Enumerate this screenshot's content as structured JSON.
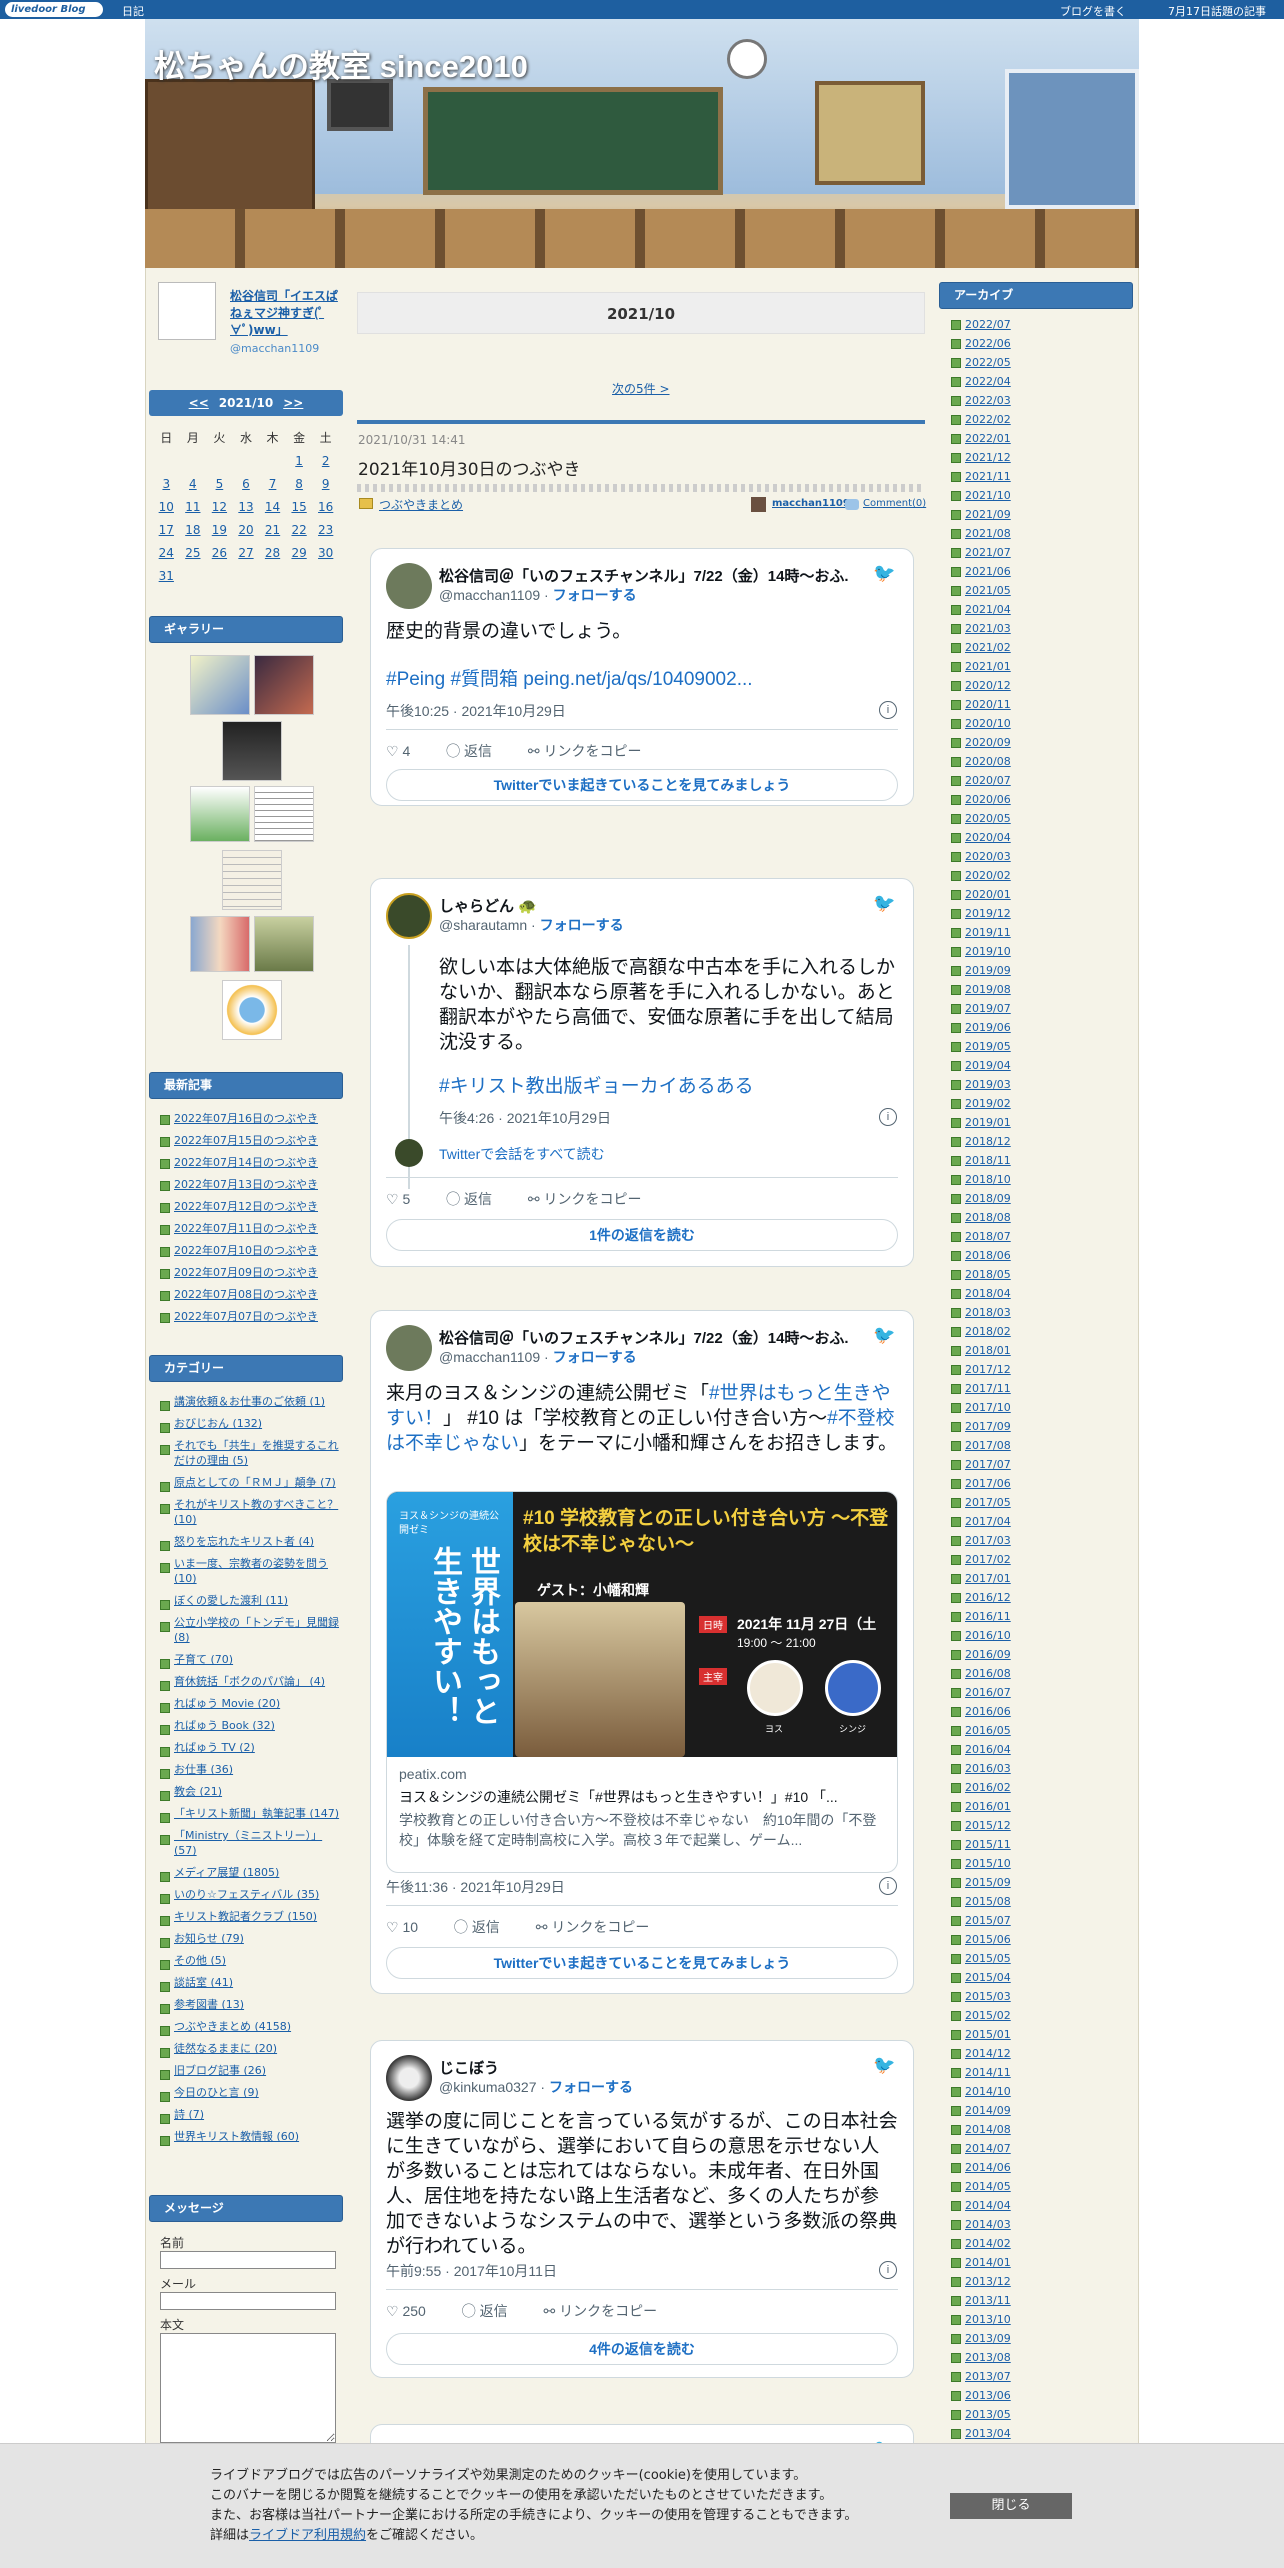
{
  "topbar": {
    "logo": "livedoor Blog",
    "diary": "日記",
    "write": "ブログを書く",
    "trend": "7月17日話題の記事"
  },
  "header": {
    "title": "松ちゃんの教室 since2010"
  },
  "profile": {
    "name": "松谷信司「イエスぱねぇマジ神すぎ(ﾟ∀ﾟ)ww」",
    "handle": "@macchan1109"
  },
  "calendar": {
    "prev": "<<",
    "month": "2021/10",
    "next": ">>",
    "weekdays": [
      "日",
      "月",
      "火",
      "水",
      "木",
      "金",
      "土"
    ],
    "weeks": [
      [
        "",
        "",
        "",
        "",
        "",
        "1",
        "2"
      ],
      [
        "3",
        "4",
        "5",
        "6",
        "7",
        "8",
        "9"
      ],
      [
        "10",
        "11",
        "12",
        "13",
        "14",
        "15",
        "16"
      ],
      [
        "17",
        "18",
        "19",
        "20",
        "21",
        "22",
        "23"
      ],
      [
        "24",
        "25",
        "26",
        "27",
        "28",
        "29",
        "30"
      ],
      [
        "31",
        "",
        "",
        "",
        "",
        "",
        ""
      ]
    ]
  },
  "gallery": {
    "title": "ギャラリー"
  },
  "recent": {
    "title": "最新記事",
    "items": [
      "2022年07月16日のつぶやき",
      "2022年07月15日のつぶやき",
      "2022年07月14日のつぶやき",
      "2022年07月13日のつぶやき",
      "2022年07月12日のつぶやき",
      "2022年07月11日のつぶやき",
      "2022年07月10日のつぶやき",
      "2022年07月09日のつぶやき",
      "2022年07月08日のつぶやき",
      "2022年07月07日のつぶやき"
    ]
  },
  "categories": {
    "title": "カテゴリー",
    "items": [
      "講演依頼＆お仕事のご依頼 (1)",
      "おびじおん (132)",
      "それでも「共生」を推奨するこれだけの理由 (5)",
      "原点としての「ＲＭＪ」顛争 (7)",
      "それがキリスト教のすべきこと？ (10)",
      "怒りを忘れたキリスト者 (4)",
      "いま一度、宗教者の姿勢を問う (10)",
      "ぼくの愛した渡利 (11)",
      "公立小学校の「トンデモ」見聞録 (8)",
      "子育て (70)",
      "育休銃括「ボクのパパ論」 (4)",
      "ればゅう Movie (20)",
      "ればゅう Book (32)",
      "ればゅう TV (2)",
      "お仕事 (36)",
      "教会 (21)",
      "「キリスト新聞」執筆記事 (147)",
      "「Ministry（ミニストリー）」 (57)",
      "メディア展望 (1805)",
      "いのり☆フェスティバル (35)",
      "キリスト教記者クラブ (150)",
      "お知らせ (79)",
      "その他 (5)",
      "談話室 (41)",
      "参考図書 (13)",
      "つぶやきまとめ (4158)",
      "徒然なるままに (20)",
      "旧ブログ記事 (26)",
      "今日のひと言 (9)",
      "詩 (7)",
      "世界キリスト教情報 (60)"
    ]
  },
  "message": {
    "title": "メッセージ",
    "name_label": "名前",
    "mail_label": "メール",
    "body_label": "本文"
  },
  "main": {
    "date_head": "2021/10",
    "next_link": "次の5件 >",
    "post_date": "2021/10/31 14:41",
    "post_title": "2021年10月30日のつぶやき",
    "category": "つぶやきまとめ",
    "author": "macchan1109",
    "comments": "Comment(0)"
  },
  "tweets": [
    {
      "name": "松谷信司＠「いのフェスチャンネル」7/22（金）14時～おふ...",
      "handle": "@macchan1109",
      "follow": "フォローする",
      "text": "歴史的背景の違いでしょう。",
      "tags": "#Peing #質問箱 peing.net/ja/qs/10409002...",
      "time": "午後10:25 · 2021年10月29日",
      "likes": "4",
      "reply": "返信",
      "copy": "リンクをコピー",
      "button": "Twitterでいま起きていることを見てみましょう"
    },
    {
      "name": "しゃらどん",
      "handle": "@sharautamn",
      "follow": "フォローする",
      "text": "欲しい本は大体絶版で高額な中古本を手に入れるしかないか、翻訳本なら原著を手に入れるしかない。あと翻訳本がやたら高価で、安価な原著に手を出して結局沈没する。",
      "tags": "#キリスト教出版ギョーカイあるある",
      "time": "午後4:26 · 2021年10月29日",
      "thread": "Twitterで会話をすべて読む",
      "likes": "5",
      "reply": "返信",
      "copy": "リンクをコピー",
      "button": "1件の返信を読む"
    },
    {
      "name": "松谷信司＠「いのフェスチャンネル」7/22（金）14時～おふ...",
      "handle": "@macchan1109",
      "follow": "フォローする",
      "text1": "来月のヨス＆シンジの連続公開ゼミ「",
      "hl1": "#世界はもっと生きやすい！",
      "text2": "」 #10 は「学校教育との正しい付き合い方～",
      "hl2": "#不登校は不幸じゃない",
      "text3": "」をテーマに小幡和輝さんをお招きします。",
      "card_banner_top": "ヨス＆シンジの連続公開ゼミ",
      "card_banner_big": "世界はもっと生きやすい！",
      "card_title": "#10 学校教育との正しい付き合い方 〜不登校は不幸じゃない〜",
      "card_guest": "ゲスト：小幡和輝",
      "card_date_tag": "日時",
      "card_date": "2021年 11月 27日（土",
      "card_hours": "19:00 ～ 21:00",
      "card_host_tag": "主宰",
      "card_host1": "ヨス",
      "card_host2": "シンジ",
      "card_domain": "peatix.com",
      "card_headline": "ヨス＆シンジの連続公開ゼミ「#世界はもっと生きやすい！」#10 「...",
      "card_desc": "学校教育との正しい付き合い方～不登校は不幸じゃない　約10年間の「不登校」体験を経て定時制高校に入学。高校３年で起業し、ゲーム...",
      "time": "午後11:36 · 2021年10月29日",
      "likes": "10",
      "reply": "返信",
      "copy": "リンクをコピー",
      "button": "Twitterでいま起きていることを見てみましょう"
    },
    {
      "name": "じこぼう",
      "handle": "@kinkuma0327",
      "follow": "フォローする",
      "text": "選挙の度に同じことを言っている気がするが、この日本社会に生きていながら、選挙において自らの意思を示せない人が多数いることは忘れてはならない。未成年者、在日外国人、居住地を持たない路上生活者など、多くの人たちが参加できないようなシステムの中で、選挙という多数派の祭典が行われている。",
      "time": "午前9:55 · 2017年10月11日",
      "likes": "250",
      "reply": "返信",
      "copy": "リンクをコピー",
      "button": "4件の返信を読む"
    }
  ],
  "archive": {
    "title": "アーカイブ",
    "items": [
      "2022/07",
      "2022/06",
      "2022/05",
      "2022/04",
      "2022/03",
      "2022/02",
      "2022/01",
      "2021/12",
      "2021/11",
      "2021/10",
      "2021/09",
      "2021/08",
      "2021/07",
      "2021/06",
      "2021/05",
      "2021/04",
      "2021/03",
      "2021/02",
      "2021/01",
      "2020/12",
      "2020/11",
      "2020/10",
      "2020/09",
      "2020/08",
      "2020/07",
      "2020/06",
      "2020/05",
      "2020/04",
      "2020/03",
      "2020/02",
      "2020/01",
      "2019/12",
      "2019/11",
      "2019/10",
      "2019/09",
      "2019/08",
      "2019/07",
      "2019/06",
      "2019/05",
      "2019/04",
      "2019/03",
      "2019/02",
      "2019/01",
      "2018/12",
      "2018/11",
      "2018/10",
      "2018/09",
      "2018/08",
      "2018/07",
      "2018/06",
      "2018/05",
      "2018/04",
      "2018/03",
      "2018/02",
      "2018/01",
      "2017/12",
      "2017/11",
      "2017/10",
      "2017/09",
      "2017/08",
      "2017/07",
      "2017/06",
      "2017/05",
      "2017/04",
      "2017/03",
      "2017/02",
      "2017/01",
      "2016/12",
      "2016/11",
      "2016/10",
      "2016/09",
      "2016/08",
      "2016/07",
      "2016/06",
      "2016/05",
      "2016/04",
      "2016/03",
      "2016/02",
      "2016/01",
      "2015/12",
      "2015/11",
      "2015/10",
      "2015/09",
      "2015/08",
      "2015/07",
      "2015/06",
      "2015/05",
      "2015/04",
      "2015/03",
      "2015/02",
      "2015/01",
      "2014/12",
      "2014/11",
      "2014/10",
      "2014/09",
      "2014/08",
      "2014/07",
      "2014/06",
      "2014/05",
      "2014/04",
      "2014/03",
      "2014/02",
      "2014/01",
      "2013/12",
      "2013/11",
      "2013/10",
      "2013/09",
      "2013/08",
      "2013/07",
      "2013/06",
      "2013/05",
      "2013/04"
    ]
  },
  "cookie": {
    "line1": "ライブドアブログでは広告のパーソナライズや効果測定のためのクッキー(cookie)を使用しています。",
    "line2": "このバナーを閉じるか閲覧を継続することでクッキーの使用を承認いただいたものとさせていただきます。",
    "line3": "また、お客様は当社パートナー企業における所定の手続きにより、クッキーの使用を管理することもできます。",
    "line4_pre": "詳細は",
    "line4_link": "ライブドア利用規約",
    "line4_post": "をご確認ください。",
    "close": "閉じる"
  }
}
